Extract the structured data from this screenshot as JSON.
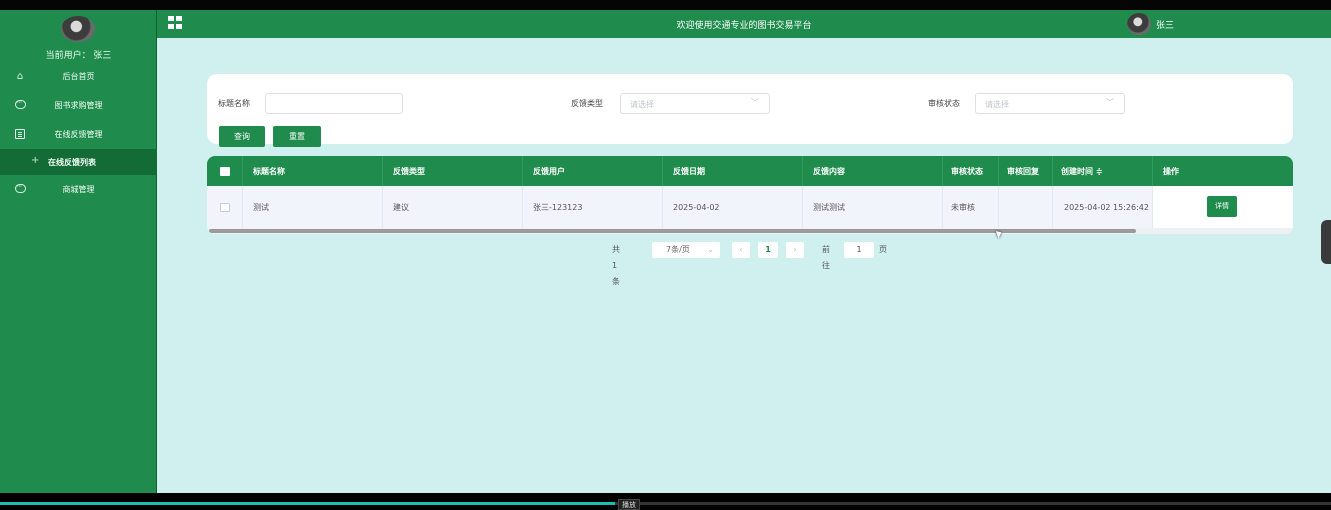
{
  "sidebar": {
    "current_user": "当前用户：  张三",
    "menu": [
      {
        "icon": "home-icon",
        "label": "后台首页"
      },
      {
        "icon": "chat-icon",
        "label": "图书求购管理"
      },
      {
        "icon": "document-icon",
        "label": "在线反馈管理"
      },
      {
        "icon": "plus-icon",
        "label": "在线反馈列表",
        "active": true
      },
      {
        "icon": "chat-icon",
        "label": "商城管理"
      }
    ]
  },
  "header": {
    "title": "欢迎使用交通专业的图书交易平台",
    "username": "张三"
  },
  "search": {
    "title_label": "标题名称",
    "title_value": "",
    "type_label": "反馈类型",
    "type_placeholder": "请选择",
    "status_label": "审核状态",
    "status_placeholder": "请选择",
    "query_button": "查询",
    "reset_button": "重置"
  },
  "table": {
    "columns": [
      "标题名称",
      "反馈类型",
      "反馈用户",
      "反馈日期",
      "反馈内容",
      "审核状态",
      "审核回复",
      "创建时间 ≑",
      "操作"
    ],
    "rows": [
      [
        "测试",
        "建议",
        "张三-123123",
        "2025-04-02",
        "测试测试",
        "未审核",
        "",
        "2025-04-02 15:26:42"
      ]
    ],
    "detail_button": "详情"
  },
  "pagination": {
    "total": "共 1 条",
    "page_size": "7条/页",
    "current_page": "1",
    "goto_label": "前往",
    "goto_value": "1",
    "page_suffix": "页"
  },
  "player": {
    "tooltip": "播放",
    "progress": 0.462
  },
  "colors": {
    "primary": "#1f8b4c",
    "background": "#cff0ef"
  }
}
